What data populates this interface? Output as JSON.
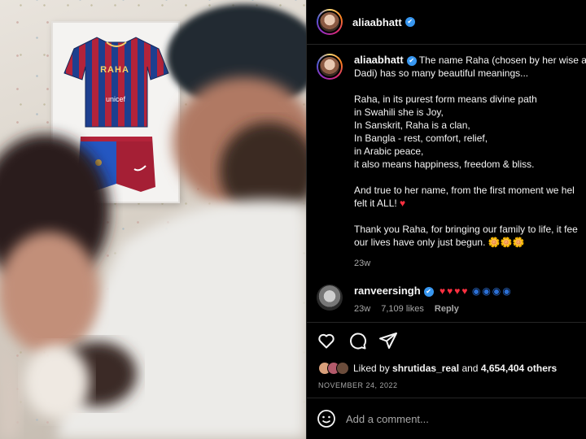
{
  "post": {
    "image_alt": "Couple holding newborn in front of framed football jersey",
    "jersey_name": "RAHA",
    "jersey_sponsor": "unicef"
  },
  "header": {
    "username": "aliaabhatt",
    "verified_glyph": "✔"
  },
  "caption": {
    "username": "aliaabhatt",
    "intro": "The name Raha (chosen by her wise an",
    "intro_2": "Dadi) has so many beautiful meanings...",
    "lines": [
      "Raha, in its purest form means divine path",
      "in Swahili she is Joy,",
      "In Sanskrit, Raha is a clan,",
      "In Bangla - rest, comfort, relief,",
      "in Arabic peace,",
      "it also means happiness, freedom & bliss."
    ],
    "para2_1": "And true to her name, from the first moment we hel",
    "para2_2": "felt it ALL!",
    "para2_emoji": "♥",
    "para3_1": "Thank you Raha, for bringing our family to life, it fee",
    "para3_2": "our lives have only just begun.",
    "para3_emoji": "🌼🌼🌼",
    "age": "23w"
  },
  "comment": {
    "username": "ranveersingh",
    "hearts": "♥♥♥♥",
    "eyes": "◉◉◉◉",
    "age": "23w",
    "likes": "7,109 likes",
    "reply_label": "Reply"
  },
  "likes": {
    "prefix": "Liked by",
    "user": "shrutidas_real",
    "middle": "and",
    "count": "4,654,404 others"
  },
  "date": "NOVEMBER 24, 2022",
  "add_comment": {
    "placeholder": "Add a comment..."
  },
  "icons": [
    "heart-icon",
    "comment-icon",
    "share-icon",
    "emoji-icon"
  ],
  "colors": {
    "background": "#000000",
    "verified": "#3897f0",
    "heart": "#ff3040"
  }
}
